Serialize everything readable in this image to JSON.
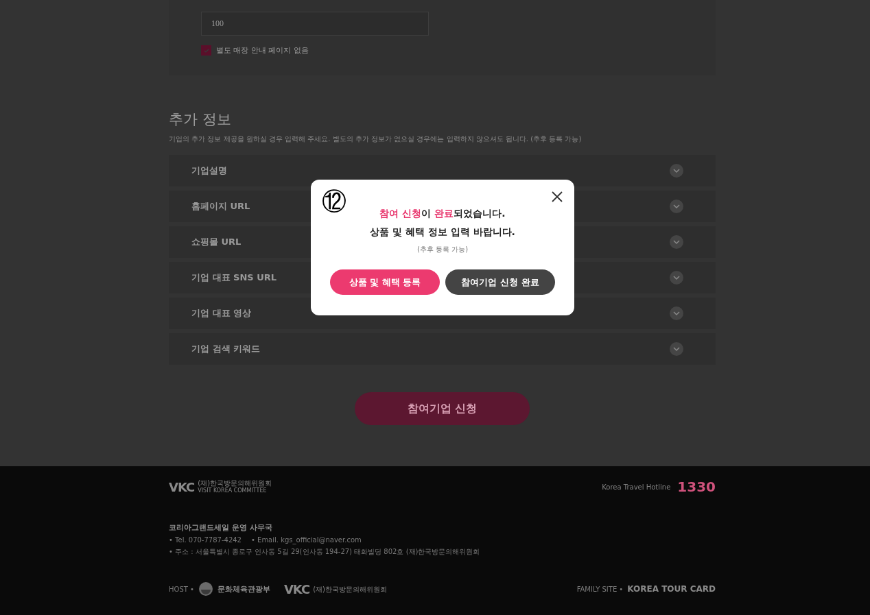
{
  "store_form": {
    "quantity_value": "100",
    "no_store_page": {
      "label": "별도 매장 안내 페이지 없음",
      "checked": true
    }
  },
  "additional_info": {
    "title": "추가 정보",
    "description": "기업의 추가 정보 제공을 원하실 경우 입력해 주세요. 별도의 추가 정보가 없으실 경우에는 입력하지 않으셔도 됩니다. (추후 등록 가능)",
    "rows": [
      {
        "label": "기업설명",
        "expanded": false
      },
      {
        "label": "홈페이지 URL",
        "expanded": false
      },
      {
        "label": "쇼핑몰 URL",
        "expanded": false
      },
      {
        "label": "기업 대표 SNS URL",
        "expanded": false
      },
      {
        "label": "기업 대표 영상",
        "expanded": false
      },
      {
        "label": "기업 검색 키워드",
        "expanded": false
      }
    ]
  },
  "submit_button": "참여기업 신청",
  "footer": {
    "logo_mark": "VKC",
    "logo_name": "(재)한국방문의해위원회",
    "logo_subname": "VISIT KOREA COMMITTEE",
    "hotline_label": "Korea Travel Hotline",
    "hotline_number": "1330",
    "office_title": "코리아그랜드세일 운영 사무국",
    "tel": "• Tel. 070-7787-4242",
    "email": "• Email. kgs_official@naver.com",
    "address": "• 주소 : 서울특별시 종로구 인사동 5길 29(인사동 194-27) 태화빌딩 802호 (재)한국방문의해위원회",
    "host_label": "HOST •",
    "host_ministry": "문화체육관광부",
    "host_logo_mark": "VKC",
    "host_logo_name": "(재)한국방문의해위원회",
    "family_label": "FAMILY SITE •",
    "family_site": "KOREA TOUR CARD"
  },
  "modal": {
    "marker": "⑫",
    "title_parts": [
      {
        "text": "참여 신청",
        "highlight": true
      },
      {
        "text": "이 ",
        "highlight": false
      },
      {
        "text": "완료",
        "highlight": true
      },
      {
        "text": "되었습니다.",
        "highlight": false
      }
    ],
    "message": "상품 및 혜택 정보 입력 바랍니다.",
    "note": "(추후 등록 가능)",
    "buttons": [
      {
        "label": "상품 및 혜택 등록",
        "kind": "primary"
      },
      {
        "label": "참여기업 신청 완료",
        "kind": "secondary"
      }
    ]
  }
}
